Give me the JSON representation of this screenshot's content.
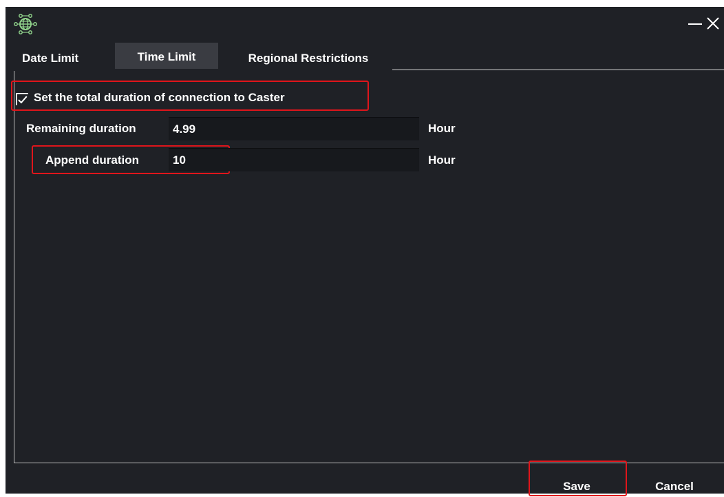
{
  "window": {
    "icon": "globe-network-icon",
    "minimize_icon": "minimize-icon",
    "close_icon": "close-icon"
  },
  "tabs": [
    {
      "label": "Date Limit",
      "active": false
    },
    {
      "label": "Time Limit",
      "active": true
    },
    {
      "label": "Regional Restrictions",
      "active": false
    }
  ],
  "time_limit": {
    "checkbox_label": "Set the total duration of connection to Caster",
    "checkbox_checked": true,
    "remaining": {
      "label": "Remaining duration",
      "value": "4.99",
      "unit": "Hour"
    },
    "append": {
      "label": "Append duration",
      "value": "10",
      "unit": "Hour"
    }
  },
  "footer": {
    "save_label": "Save",
    "cancel_label": "Cancel"
  },
  "colors": {
    "background": "#1f2126",
    "input_background": "#17191d",
    "active_tab": "#3a3c42",
    "highlight": "#e0151b",
    "icon_accent": "#8fd18a"
  }
}
